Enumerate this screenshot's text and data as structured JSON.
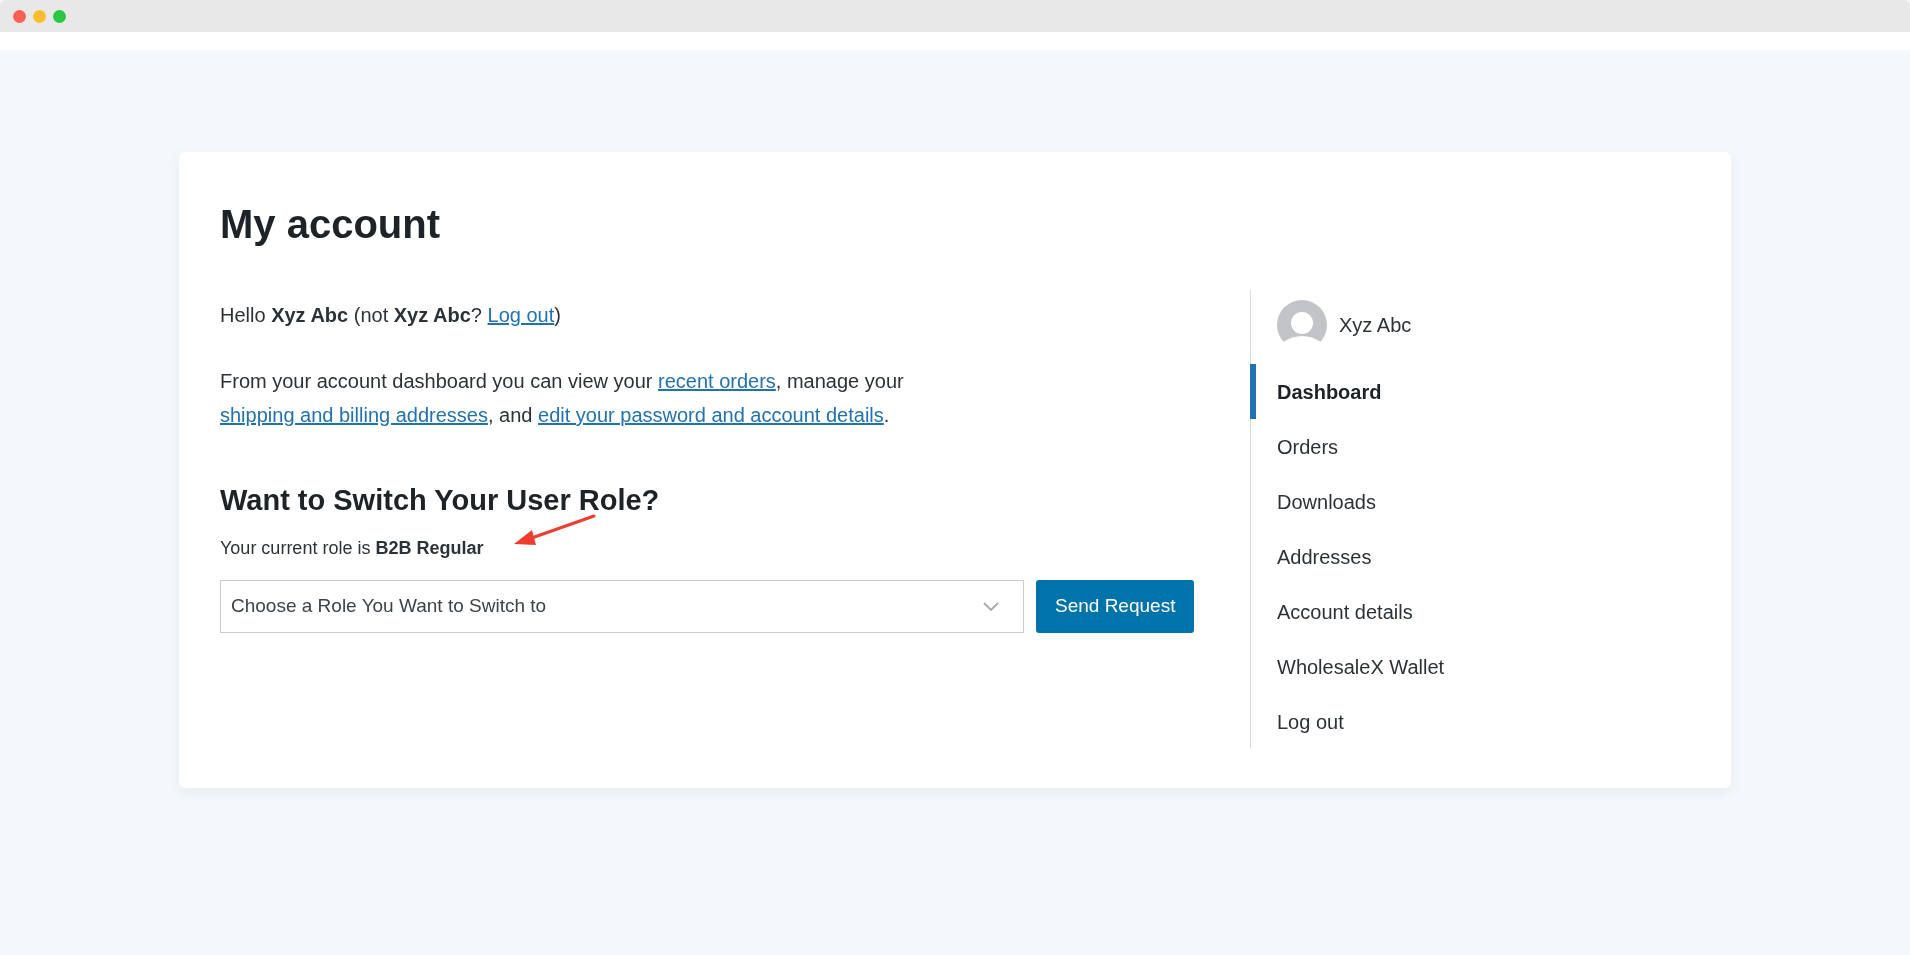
{
  "page": {
    "title": "My account"
  },
  "greeting": [
    {
      "kind": "text",
      "text": "Hello "
    },
    {
      "kind": "bold",
      "text": "Xyz Abc"
    },
    {
      "kind": "text",
      "text": " (not "
    },
    {
      "kind": "bold",
      "text": "Xyz Abc"
    },
    {
      "kind": "text",
      "text": "? "
    },
    {
      "kind": "link",
      "text": "Log out"
    },
    {
      "kind": "text",
      "text": ")"
    }
  ],
  "intro": [
    {
      "kind": "text",
      "text": "From your account dashboard you can view your "
    },
    {
      "kind": "link",
      "text": "recent orders"
    },
    {
      "kind": "text",
      "text": ", manage your "
    },
    {
      "kind": "link",
      "text": "shipping and billing addresses"
    },
    {
      "kind": "text",
      "text": ", and "
    },
    {
      "kind": "link",
      "text": "edit your password and account details"
    },
    {
      "kind": "text",
      "text": "."
    }
  ],
  "role_switch": {
    "heading": "Want to Switch Your User Role?",
    "current_role": "Your current role is **B2B Regular**",
    "select": {
      "placeholder": "Choose a Role You Want to Switch to"
    },
    "button": "Send Request"
  },
  "sidebar": {
    "user": "Xyz Abc",
    "items": [
      {
        "label": "Dashboard",
        "selected": true
      },
      {
        "label": "Orders",
        "selected": false
      },
      {
        "label": "Downloads",
        "selected": false
      },
      {
        "label": "Addresses",
        "selected": false
      },
      {
        "label": "Account details",
        "selected": false
      },
      {
        "label": "WholesaleX Wallet",
        "selected": false
      },
      {
        "label": "Log out",
        "selected": false
      }
    ]
  }
}
